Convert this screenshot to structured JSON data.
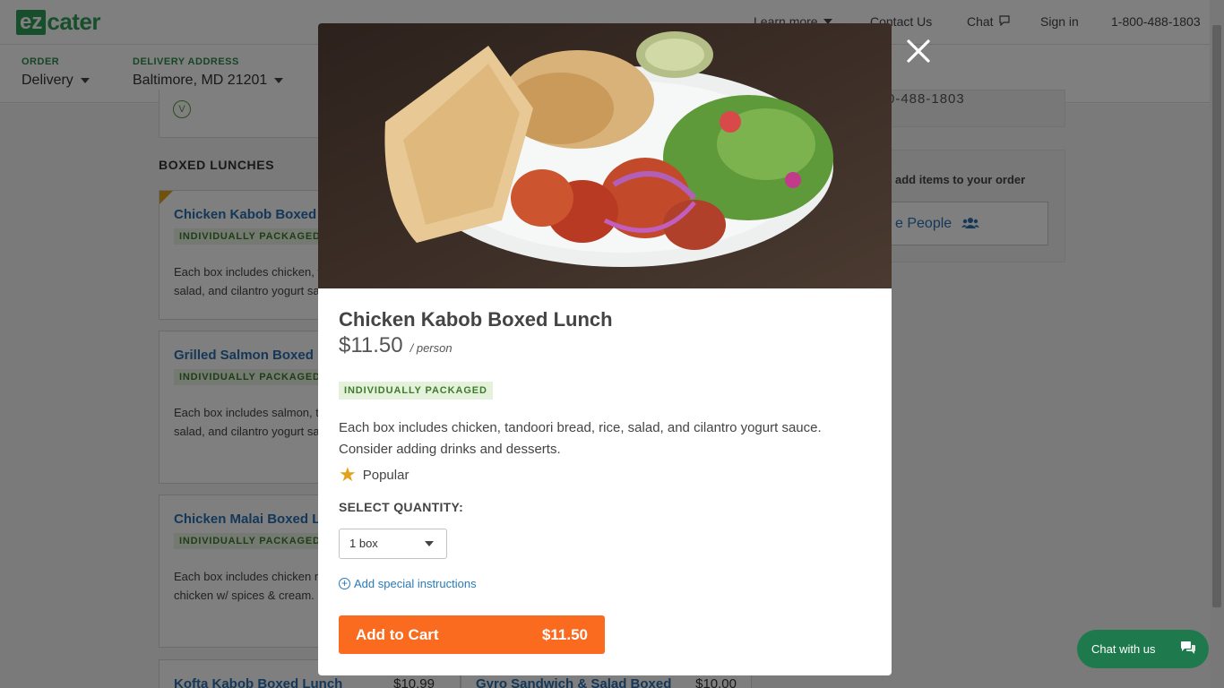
{
  "header": {
    "logo_ez": "ez",
    "logo_cater": "cater",
    "learn_more": "Learn more",
    "contact_us": "Contact Us",
    "chat": "Chat",
    "sign_in": "Sign in",
    "phone": "1-800-488-1803"
  },
  "subbar": {
    "order_label": "ORDER",
    "order_value": "Delivery",
    "address_label": "DELIVERY ADDRESS",
    "address_value": "Baltimore, MD 21201"
  },
  "menu": {
    "veg_badge": "V",
    "section_title": "BOXED LUNCHES",
    "items": [
      {
        "title": "Chicken Kabob Boxed Lunch",
        "tag": "INDIVIDUALLY PACKAGED",
        "desc": "Each box includes chicken, tandoori bread, rice, salad, and cilantro yogurt sauce."
      },
      {
        "title": "Grilled Salmon Boxed Lunch",
        "tag": "INDIVIDUALLY PACKAGED",
        "desc": "Each box includes salmon, tandoori bread, rice, salad, and cilantro yogurt sauce."
      },
      {
        "title": "Chicken Malai Boxed Lunch",
        "tag": "INDIVIDUALLY PACKAGED",
        "desc": "Each box includes chicken malai, marinated chicken w/ spices & cream."
      },
      {
        "title": "Kofta Kabob Boxed Lunch",
        "price": "$10.99"
      },
      {
        "title": "Gyro Sandwich & Salad Boxed",
        "price": "$10.00"
      }
    ]
  },
  "sidebar": {
    "phone_partial": "0-488-1803",
    "hint": "add items to your order",
    "people_button": "e People"
  },
  "modal": {
    "title": "Chicken Kabob Boxed Lunch",
    "price": "$11.50",
    "per": "/ person",
    "tag": "INDIVIDUALLY PACKAGED",
    "description": "Each box includes chicken, tandoori bread, rice, salad, and cilantro yogurt sauce. Consider adding drinks and desserts.",
    "popular": "Popular",
    "qty_label": "SELECT QUANTITY:",
    "qty_value": "1 box",
    "special_instructions": "Add special instructions",
    "add_to_cart": "Add to Cart",
    "cart_price": "$11.50"
  },
  "chat_widget": {
    "label": "Chat with us"
  },
  "colors": {
    "brand_green": "#2f9e58",
    "link_blue": "#2a6fb0",
    "cta_orange": "#fa6a1f",
    "star_gold": "#e0a21b",
    "chat_green": "#1e7a4d"
  },
  "icons": [
    "close-icon",
    "star-icon",
    "chevron-down-icon",
    "plus-circle-icon",
    "chat-bubble-icon",
    "users-icon"
  ]
}
